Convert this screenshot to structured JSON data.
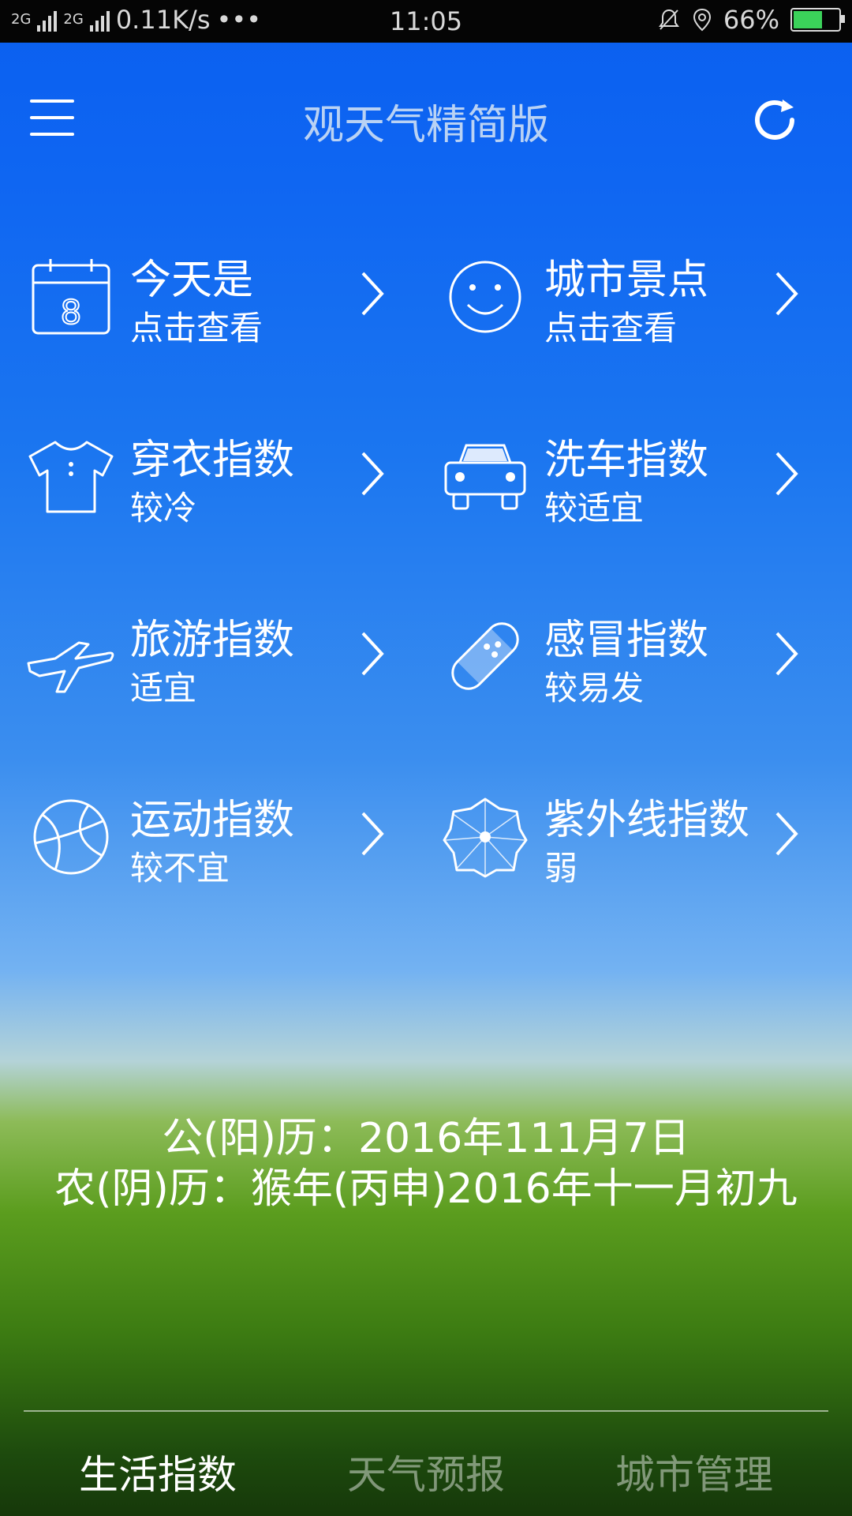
{
  "status_bar": {
    "network_1": "2G",
    "network_2": "2G",
    "network_3": "2G",
    "speed": "0.11K/s",
    "more": "•••",
    "time": "11:05",
    "battery_percent": "66%",
    "battery_level": 0.66
  },
  "header": {
    "title": "观天气精简版",
    "menu_icon": "hamburger-icon",
    "refresh_icon": "refresh-icon"
  },
  "indices": [
    {
      "title": "今天是",
      "value": "点击查看",
      "icon": "calendar-icon"
    },
    {
      "title": "城市景点",
      "value": "点击查看",
      "icon": "smiley-icon"
    },
    {
      "title": "穿衣指数",
      "value": "较冷",
      "icon": "tshirt-icon"
    },
    {
      "title": "洗车指数",
      "value": "较适宜",
      "icon": "car-icon"
    },
    {
      "title": "旅游指数",
      "value": "适宜",
      "icon": "airplane-icon"
    },
    {
      "title": "感冒指数",
      "value": "较易发",
      "icon": "bandage-icon"
    },
    {
      "title": "运动指数",
      "value": "较不宜",
      "icon": "basketball-icon"
    },
    {
      "title": "紫外线指数",
      "value": "弱",
      "icon": "umbrella-icon"
    }
  ],
  "dates": {
    "solar": "公(阳)历：2016年111月7日",
    "lunar": "农(阴)历：猴年(丙申)2016年十一月初九"
  },
  "tabs": [
    {
      "label": "生活指数",
      "active": true
    },
    {
      "label": "天气预报",
      "active": false
    },
    {
      "label": "城市管理",
      "active": false
    }
  ]
}
